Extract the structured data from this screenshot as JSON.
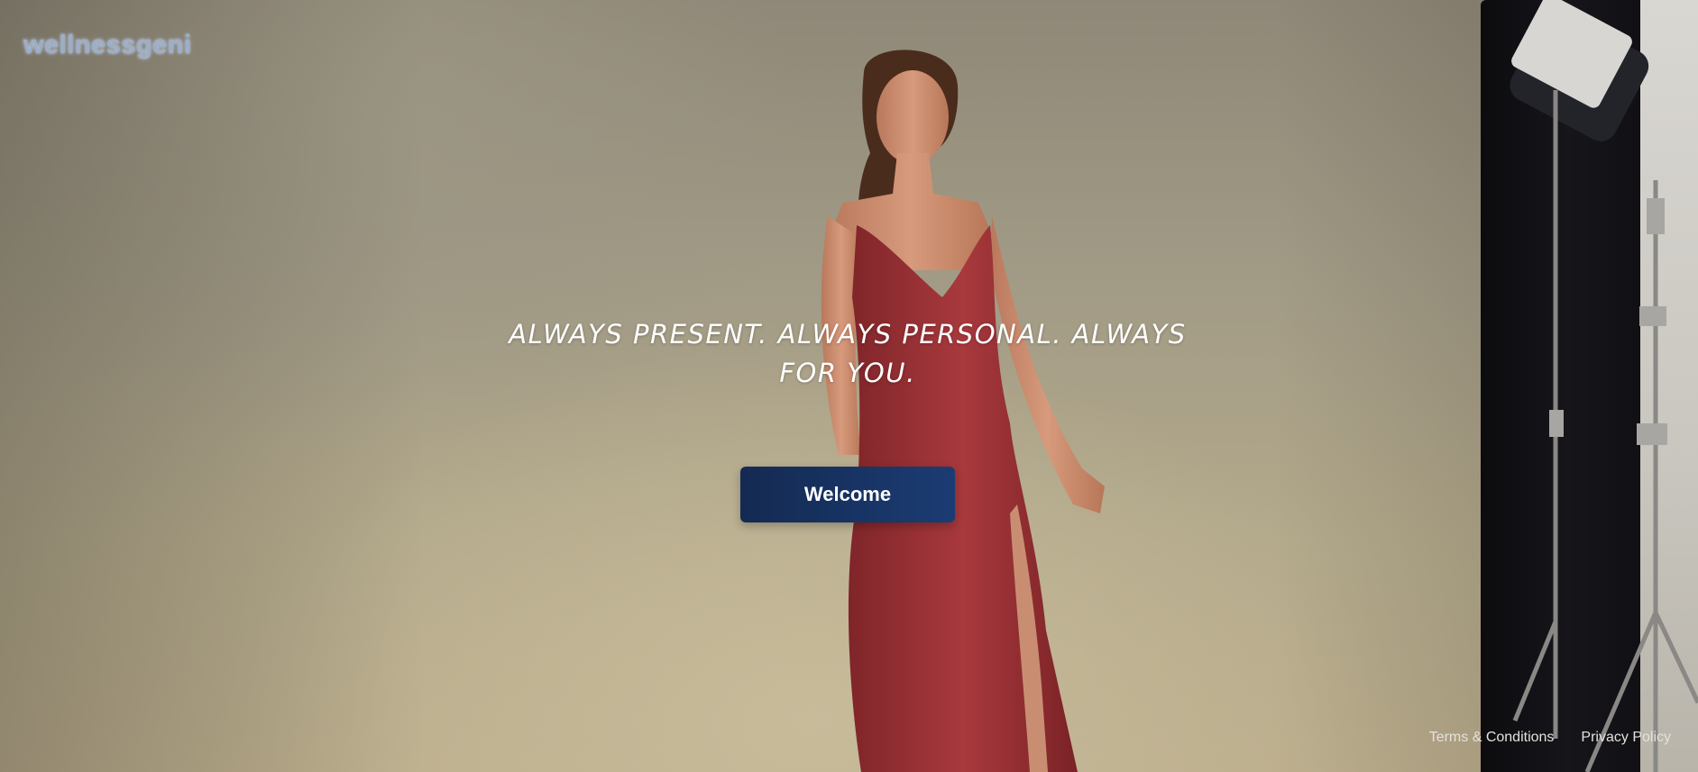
{
  "brand": {
    "logo_text": "wellnessgeni"
  },
  "hero": {
    "tagline": "ALWAYS PRESENT. ALWAYS PERSONAL. ALWAYS FOR YOU.",
    "cta_label": "Welcome"
  },
  "footer": {
    "terms_label": "Terms & Conditions",
    "privacy_label": "Privacy Policy"
  },
  "colors": {
    "button_bg": "#1b3c73",
    "dress": "#9e3438",
    "logo": "#9fb4d4"
  }
}
